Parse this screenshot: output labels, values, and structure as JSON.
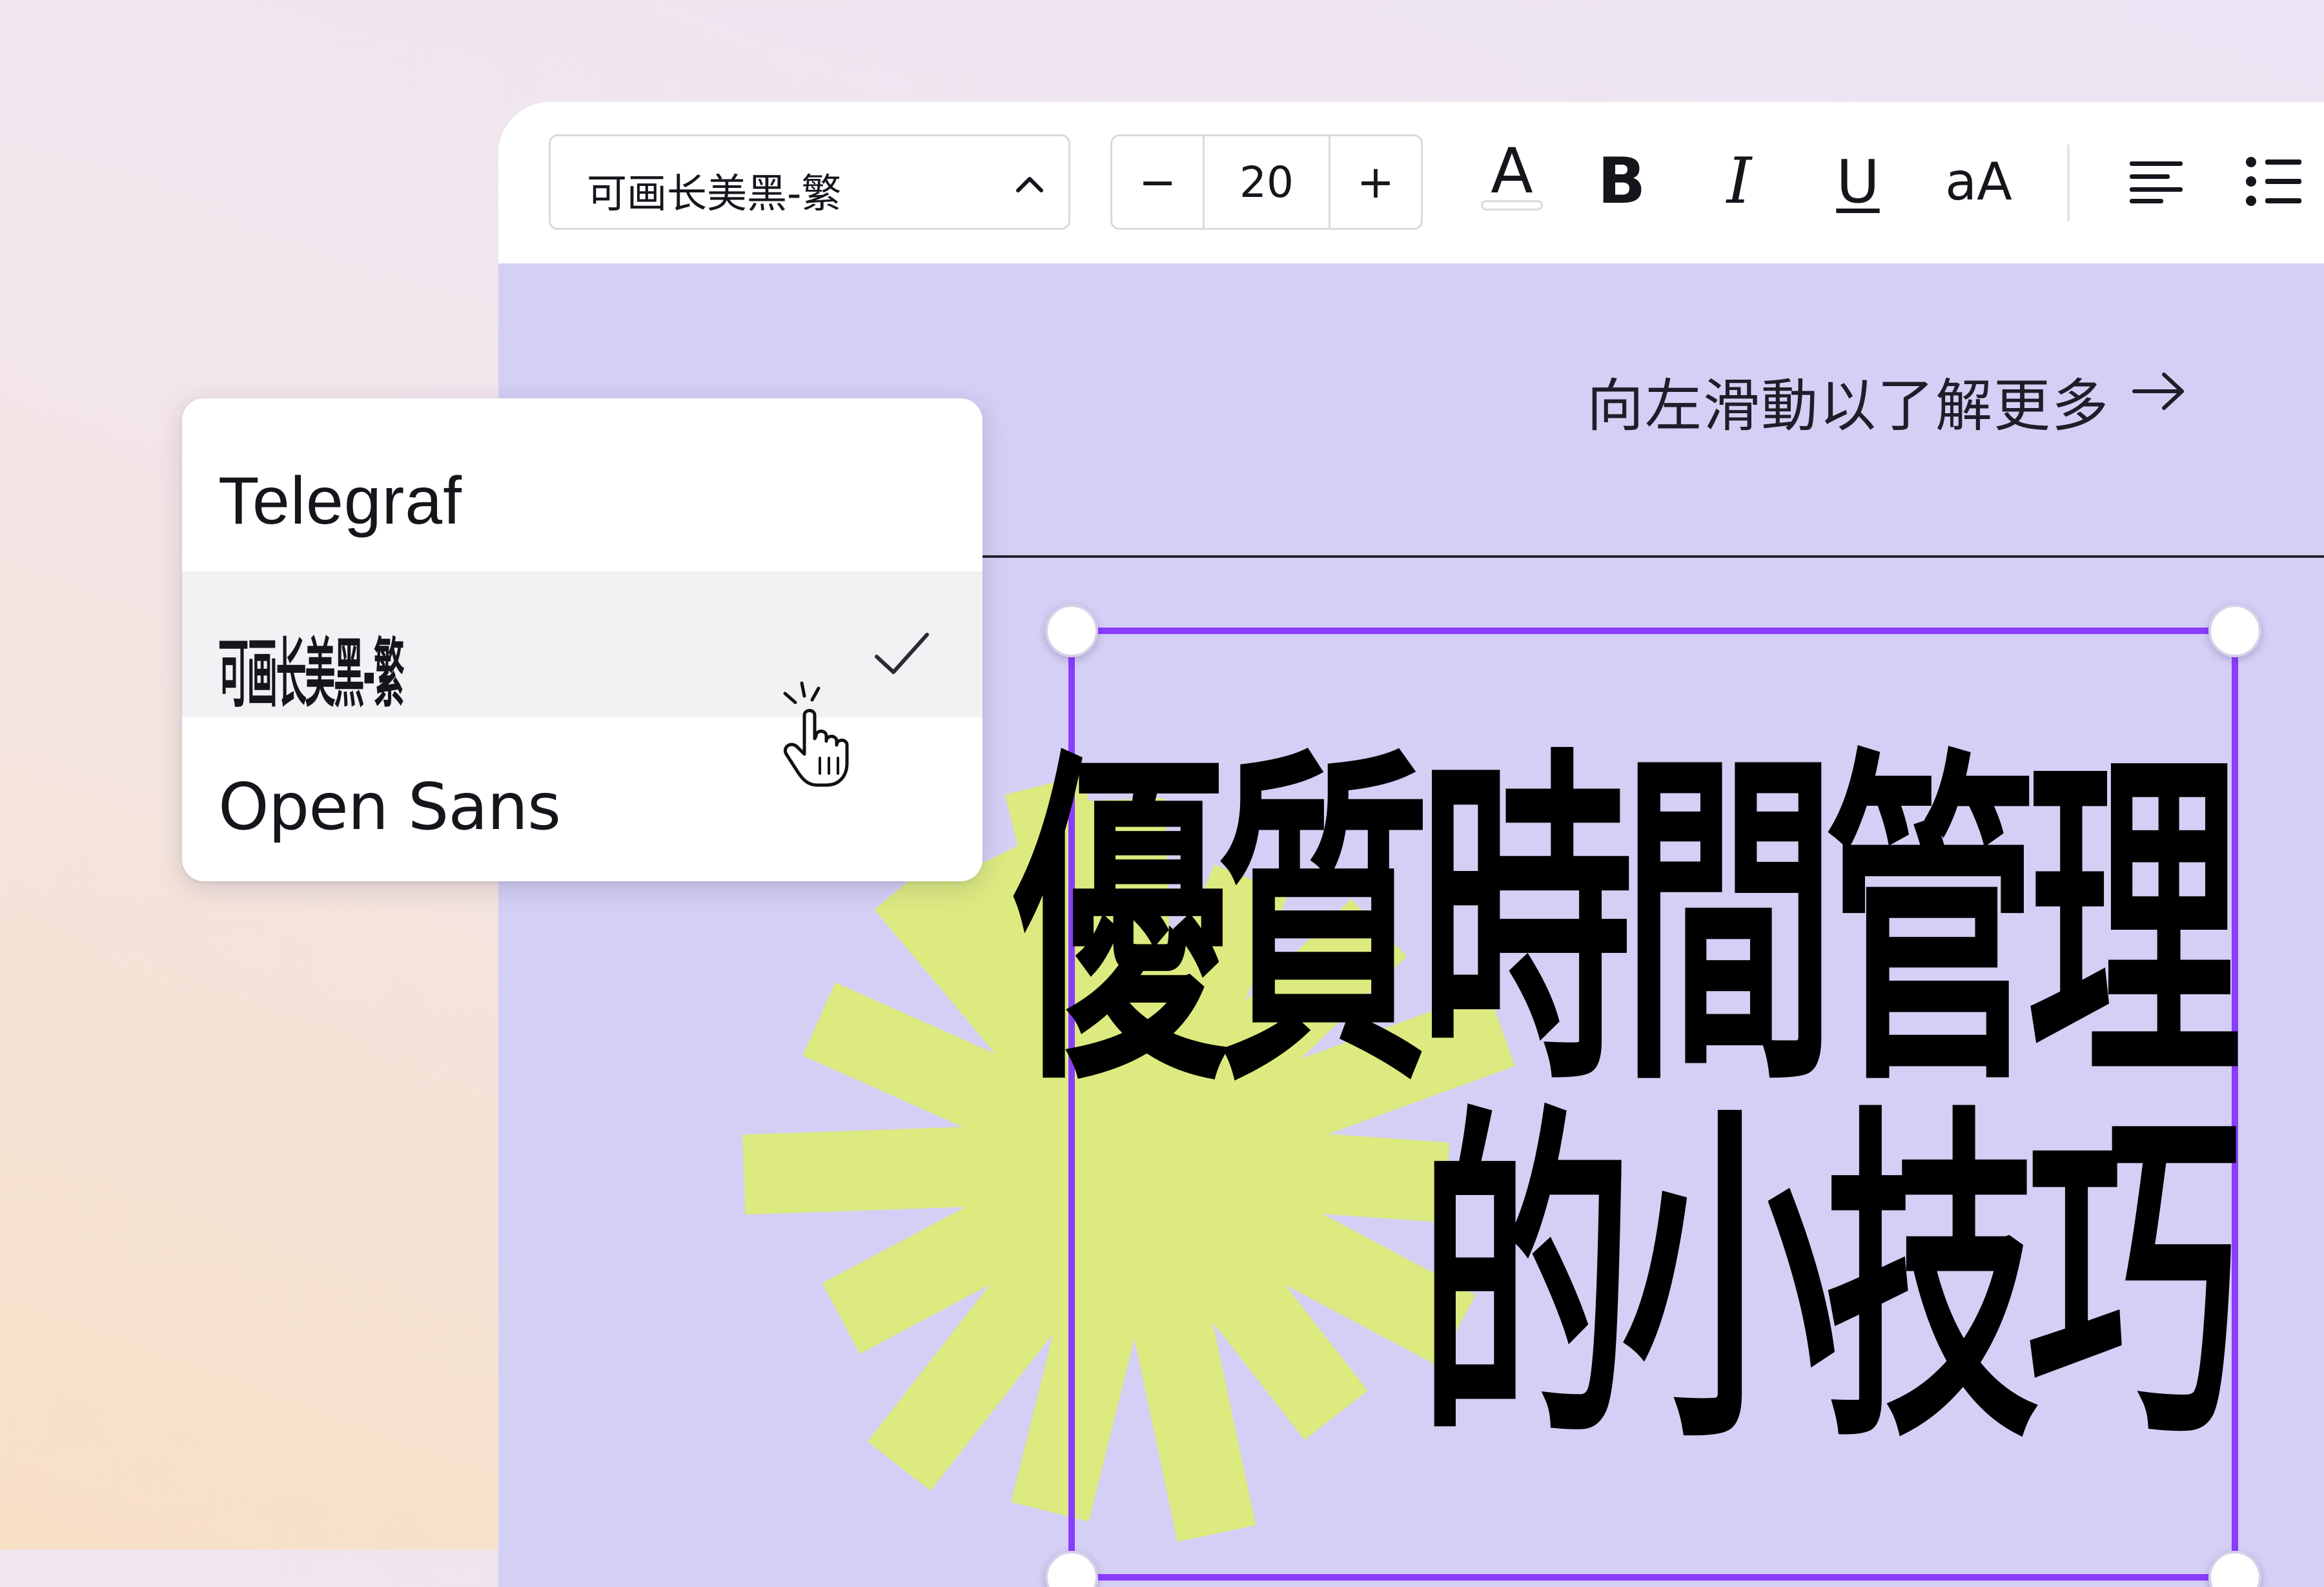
{
  "toolbar": {
    "font_select": {
      "value": "可画长美黑-繁",
      "icon": "chevron-up-icon"
    },
    "size_stepper": {
      "decrement": "−",
      "value": "20",
      "increment": "+"
    },
    "text_color": {
      "glyph": "A",
      "icon": "text-color-icon"
    },
    "bold": {
      "glyph": "B",
      "icon": "bold-icon"
    },
    "italic": {
      "glyph": "I",
      "icon": "italic-icon"
    },
    "underline": {
      "glyph": "U",
      "icon": "underline-icon"
    },
    "letter_case": {
      "glyph": "aA",
      "icon": "letter-case-icon"
    },
    "align": {
      "icon": "align-left-icon"
    },
    "list": {
      "icon": "bullet-list-icon"
    }
  },
  "font_dropdown": {
    "options": [
      {
        "label": "Telegraf",
        "selected": false
      },
      {
        "label": "可画长美黑-繁",
        "selected": true
      },
      {
        "label": "Open Sans",
        "selected": false
      }
    ],
    "selected_icon": "checkmark-icon",
    "cursor_icon": "pointer-hand-icon"
  },
  "canvas": {
    "swipe_hint": "向左滑動以了解更多",
    "swipe_icon": "arrow-right-icon",
    "headline": {
      "line1": "優質時間管理",
      "line2": "的小技巧"
    },
    "decoration": "starburst-shape",
    "colors": {
      "background": "#d4cff4",
      "selection": "#8b3dff",
      "starburst": "#dcea80"
    }
  }
}
